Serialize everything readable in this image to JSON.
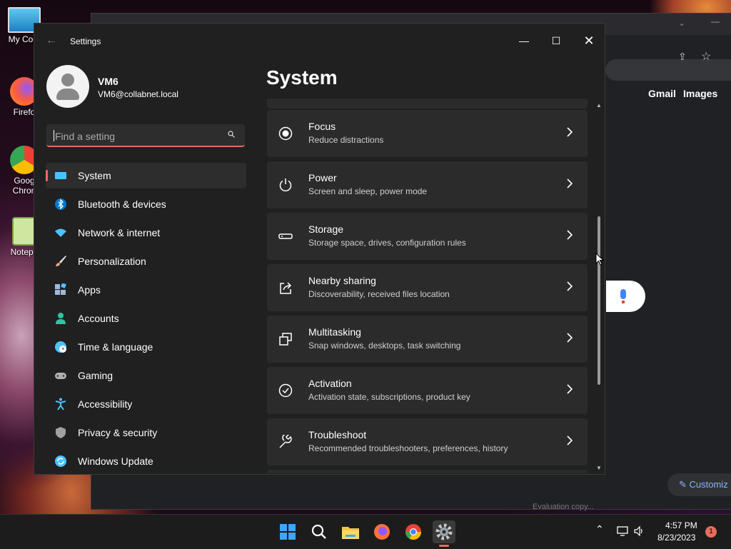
{
  "desktop": {
    "icons": [
      {
        "label": "My Com",
        "icon": "computer-icon"
      },
      {
        "label": "Firefo",
        "icon": "firefox-icon"
      },
      {
        "label": "Goog\nChron",
        "icon": "chrome-icon"
      },
      {
        "label": "Notepa",
        "icon": "notepad-icon"
      }
    ]
  },
  "browser": {
    "links": [
      "Gmail",
      "Images"
    ],
    "customize_label": "Customiz",
    "footer_text": "Evaluation copy..."
  },
  "settings": {
    "window_title": "Settings",
    "user": {
      "name": "VM6",
      "email": "VM6@collabnet.local"
    },
    "search": {
      "placeholder": "Find a setting"
    },
    "nav": [
      {
        "label": "System",
        "icon": "system-icon",
        "color": "#4cc2ff",
        "selected": true
      },
      {
        "label": "Bluetooth & devices",
        "icon": "bluetooth-icon",
        "color": "#0078d4"
      },
      {
        "label": "Network & internet",
        "icon": "wifi-icon",
        "color": "#4cc2ff"
      },
      {
        "label": "Personalization",
        "icon": "brush-icon",
        "color": "#e8a87c"
      },
      {
        "label": "Apps",
        "icon": "apps-icon",
        "color": "#9fb8d9"
      },
      {
        "label": "Accounts",
        "icon": "accounts-icon",
        "color": "#30c3a3"
      },
      {
        "label": "Time & language",
        "icon": "globe-clock-icon",
        "color": "#4cc2ff"
      },
      {
        "label": "Gaming",
        "icon": "gamepad-icon",
        "color": "#b0b0b0"
      },
      {
        "label": "Accessibility",
        "icon": "accessibility-icon",
        "color": "#4cc2ff"
      },
      {
        "label": "Privacy & security",
        "icon": "shield-icon",
        "color": "#a0a0a0"
      },
      {
        "label": "Windows Update",
        "icon": "update-icon",
        "color": "#4cc2ff"
      }
    ],
    "page_title": "System",
    "cards": [
      {
        "title": "Focus",
        "subtitle": "Reduce distractions",
        "icon": "focus-icon"
      },
      {
        "title": "Power",
        "subtitle": "Screen and sleep, power mode",
        "icon": "power-icon"
      },
      {
        "title": "Storage",
        "subtitle": "Storage space, drives, configuration rules",
        "icon": "storage-icon"
      },
      {
        "title": "Nearby sharing",
        "subtitle": "Discoverability, received files location",
        "icon": "share-icon"
      },
      {
        "title": "Multitasking",
        "subtitle": "Snap windows, desktops, task switching",
        "icon": "multitasking-icon"
      },
      {
        "title": "Activation",
        "subtitle": "Activation state, subscriptions, product key",
        "icon": "activation-icon"
      },
      {
        "title": "Troubleshoot",
        "subtitle": "Recommended troubleshooters, preferences, history",
        "icon": "wrench-icon"
      }
    ]
  },
  "taskbar": {
    "apps": [
      "windows-start-icon",
      "search-icon",
      "file-explorer-icon",
      "firefox-icon",
      "chrome-icon",
      "settings-icon"
    ],
    "time": "4:57 PM",
    "date": "8/23/2023",
    "notification_count": "1"
  }
}
